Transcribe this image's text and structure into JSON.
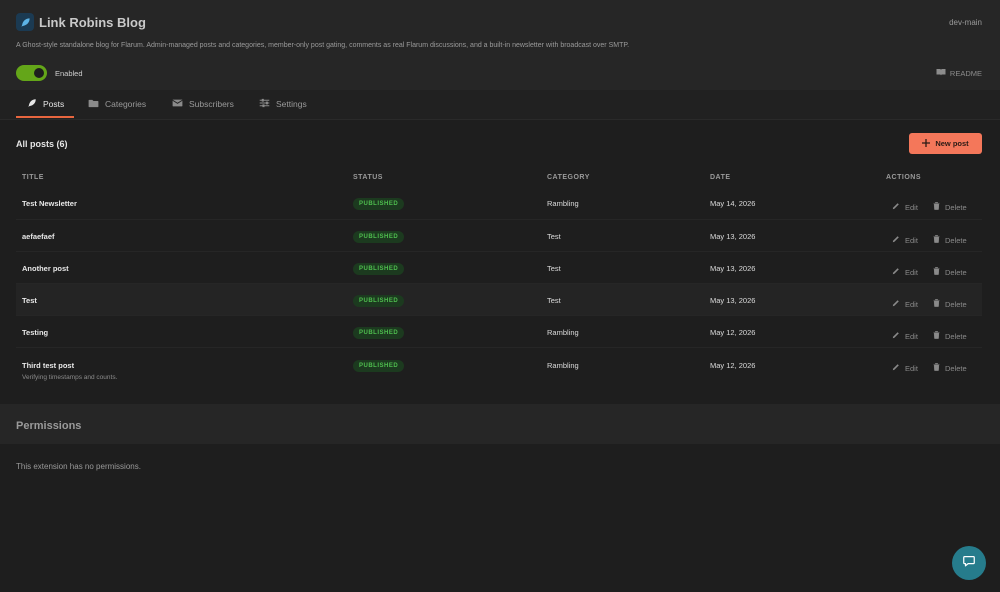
{
  "header": {
    "title": "Link Robins Blog",
    "version": "dev-main",
    "description": "A Ghost-style standalone blog for Flarum. Admin-managed posts and categories, member-only post gating, comments as real Flarum discussions, and a built-in newsletter with broadcast over SMTP.",
    "enabled_label": "Enabled",
    "readme_label": "README",
    "enabled": true
  },
  "tabs": [
    {
      "label": "Posts",
      "icon": "feather-icon",
      "active": true
    },
    {
      "label": "Categories",
      "icon": "folder-icon",
      "active": false
    },
    {
      "label": "Subscribers",
      "icon": "envelope-icon",
      "active": false
    },
    {
      "label": "Settings",
      "icon": "sliders-icon",
      "active": false
    }
  ],
  "posts": {
    "heading": "All posts (6)",
    "new_post_label": "New post",
    "columns": [
      "TITLE",
      "STATUS",
      "CATEGORY",
      "DATE",
      "ACTIONS"
    ],
    "rows": [
      {
        "title": "Test Newsletter",
        "subtitle": "",
        "status": "PUBLISHED",
        "category": "Rambling",
        "date": "May 14, 2026"
      },
      {
        "title": "aefaefaef",
        "subtitle": "",
        "status": "PUBLISHED",
        "category": "Test",
        "date": "May 13, 2026"
      },
      {
        "title": "Another post",
        "subtitle": "",
        "status": "PUBLISHED",
        "category": "Test",
        "date": "May 13, 2026"
      },
      {
        "title": "Test",
        "subtitle": "",
        "status": "PUBLISHED",
        "category": "Test",
        "date": "May 13, 2026"
      },
      {
        "title": "Testing",
        "subtitle": "",
        "status": "PUBLISHED",
        "category": "Rambling",
        "date": "May 12, 2026"
      },
      {
        "title": "Third test post",
        "subtitle": "Verifying timestamps and counts.",
        "status": "PUBLISHED",
        "category": "Rambling",
        "date": "May 12, 2026"
      }
    ],
    "edit_label": "Edit",
    "delete_label": "Delete"
  },
  "permissions": {
    "title": "Permissions",
    "text": "This extension has no permissions."
  },
  "colors": {
    "accent": "#f4775a",
    "toggle_on": "#64a619",
    "badge_text": "#4fbf4f",
    "chat": "#267c8c"
  }
}
